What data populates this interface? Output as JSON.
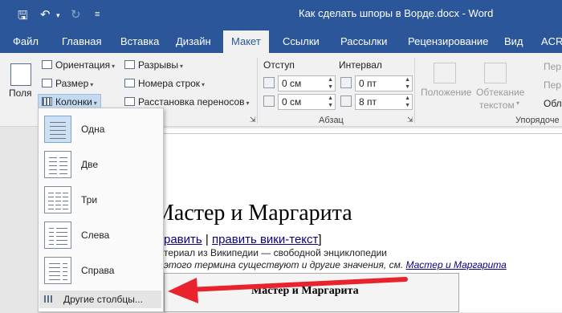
{
  "window": {
    "title": "Как сделать шпоры в Ворде.docx - Word"
  },
  "quick_access": {
    "save_icon": "save-icon",
    "undo_icon": "undo-icon",
    "redo_icon": "redo-icon",
    "customize_icon": "customize-icon"
  },
  "tabs": [
    {
      "label": "Файл",
      "active": false
    },
    {
      "label": "Главная",
      "active": false
    },
    {
      "label": "Вставка",
      "active": false
    },
    {
      "label": "Дизайн",
      "active": false
    },
    {
      "label": "Макет",
      "active": true
    },
    {
      "label": "Ссылки",
      "active": false
    },
    {
      "label": "Рассылки",
      "active": false
    },
    {
      "label": "Рецензирование",
      "active": false
    },
    {
      "label": "Вид",
      "active": false
    },
    {
      "label": "ACRO",
      "active": false
    }
  ],
  "ribbon": {
    "fields_label": "Поля",
    "orientation": "Ориентация",
    "size": "Размер",
    "columns": "Колонки",
    "breaks": "Разрывы",
    "line_numbers": "Номера строк",
    "hyphenation": "Расстановка переносов",
    "indent_label": "Отступ",
    "spacing_label": "Интервал",
    "indent_left": "0 см",
    "indent_right": "0 см",
    "spacing_before": "0 пт",
    "spacing_after": "8 пт",
    "paragraph_group": "Абзац",
    "position": "Положение",
    "wrap_line1": "Обтекание",
    "wrap_line2": "текстом",
    "side_item1": "Пер",
    "side_item2": "Пер",
    "side_item3": "Обл",
    "arrange_group": "Упорядоче"
  },
  "columns_menu": {
    "items": [
      {
        "label": "Одна",
        "selected": true
      },
      {
        "label": "Две",
        "selected": false
      },
      {
        "label": "Три",
        "selected": false
      },
      {
        "label": "Слева",
        "selected": false
      },
      {
        "label": "Справа",
        "selected": false
      }
    ],
    "more": "Другие столбцы..."
  },
  "document": {
    "heading": "Мастер и Маргарита",
    "edit_link1": "равить",
    "edit_sep": " | ",
    "edit_link2": "править вики-текст",
    "edit_end": "]",
    "subtitle": "териал из Википедии — свободной энциклопедии",
    "hatnote_text": "этого термина существуют и другие значения, см. ",
    "hatnote_link": "Мастер и Маргарита",
    "infobox_title": "Мастер и Маргарита"
  },
  "colors": {
    "accent": "#2b579a",
    "arrow": "#e8232d",
    "link": "#0b0080"
  }
}
